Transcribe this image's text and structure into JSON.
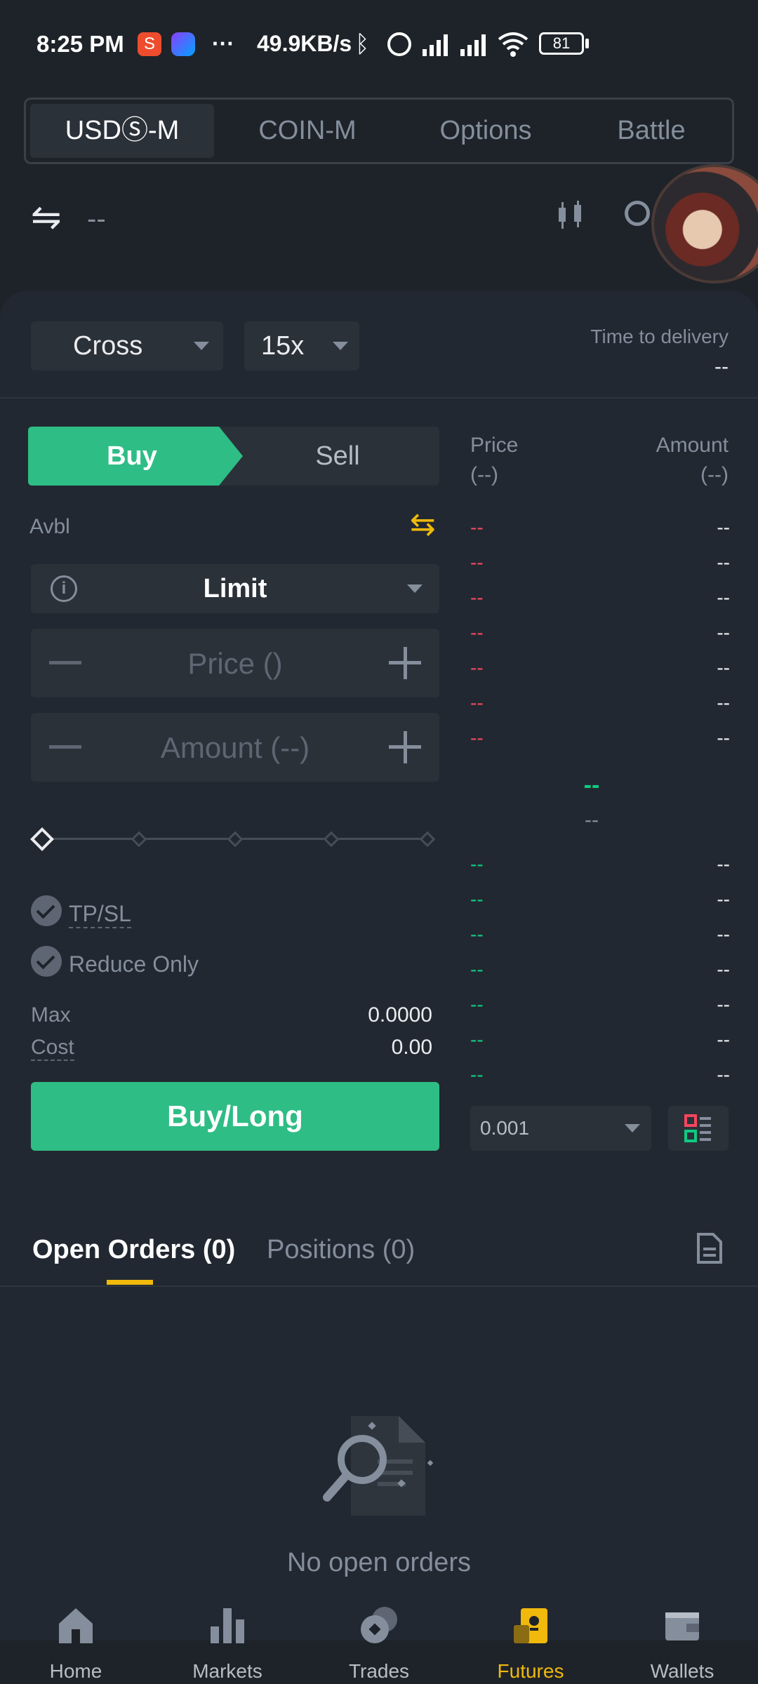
{
  "status_bar": {
    "time": "8:25 PM",
    "dots": "···",
    "network_speed": "49.9KB/s",
    "battery": "81",
    "icons": [
      "shopee-icon",
      "messenger-icon",
      "bluetooth-icon",
      "alarm-icon",
      "signal-icon",
      "signal-icon",
      "wifi-icon",
      "battery-icon"
    ]
  },
  "top_tabs": [
    {
      "label": "USDⓈ-M",
      "active": true
    },
    {
      "label": "COIN-M",
      "active": false
    },
    {
      "label": "Options",
      "active": false
    },
    {
      "label": "Battle",
      "active": false
    }
  ],
  "header": {
    "symbol": "--",
    "icons": [
      "swap-icon",
      "candlestick-chart-icon",
      "more-icon"
    ]
  },
  "margin": {
    "mode": "Cross",
    "leverage": "15x",
    "delivery_label": "Time to delivery",
    "delivery_value": "--"
  },
  "trade": {
    "buy_label": "Buy",
    "sell_label": "Sell",
    "avbl_label": "Avbl",
    "order_type": "Limit",
    "price_placeholder": "Price ()",
    "amount_placeholder": "Amount (--)",
    "slider_level": 0,
    "tpsl_label": "TP/SL",
    "reduce_only_label": "Reduce Only",
    "max_label": "Max",
    "max_value": "0.0000",
    "cost_label": "Cost",
    "cost_value": "0.00",
    "submit_label": "Buy/Long"
  },
  "orderbook": {
    "price_header": "Price",
    "price_unit": "(--)",
    "amount_header": "Amount",
    "amount_unit": "(--)",
    "asks": [
      {
        "price": "--",
        "amount": "--"
      },
      {
        "price": "--",
        "amount": "--"
      },
      {
        "price": "--",
        "amount": "--"
      },
      {
        "price": "--",
        "amount": "--"
      },
      {
        "price": "--",
        "amount": "--"
      },
      {
        "price": "--",
        "amount": "--"
      },
      {
        "price": "--",
        "amount": "--"
      }
    ],
    "last_price": "--",
    "mark_price": "--",
    "bids": [
      {
        "price": "--",
        "amount": "--"
      },
      {
        "price": "--",
        "amount": "--"
      },
      {
        "price": "--",
        "amount": "--"
      },
      {
        "price": "--",
        "amount": "--"
      },
      {
        "price": "--",
        "amount": "--"
      },
      {
        "price": "--",
        "amount": "--"
      },
      {
        "price": "--",
        "amount": "--"
      }
    ],
    "precision": "0.001"
  },
  "orders": {
    "open_orders_tab": "Open Orders (0)",
    "positions_tab": "Positions (0)",
    "empty_text": "No open orders"
  },
  "nav": [
    {
      "label": "Home",
      "active": false
    },
    {
      "label": "Markets",
      "active": false
    },
    {
      "label": "Trades",
      "active": false
    },
    {
      "label": "Futures",
      "active": true
    },
    {
      "label": "Wallets",
      "active": false
    }
  ],
  "colors": {
    "background": "#1e2329",
    "panel": "#222831",
    "buy_green": "#2ebd85",
    "sell_red": "#f6465d",
    "accent_yellow": "#f0b90b",
    "muted": "#848e9c"
  }
}
